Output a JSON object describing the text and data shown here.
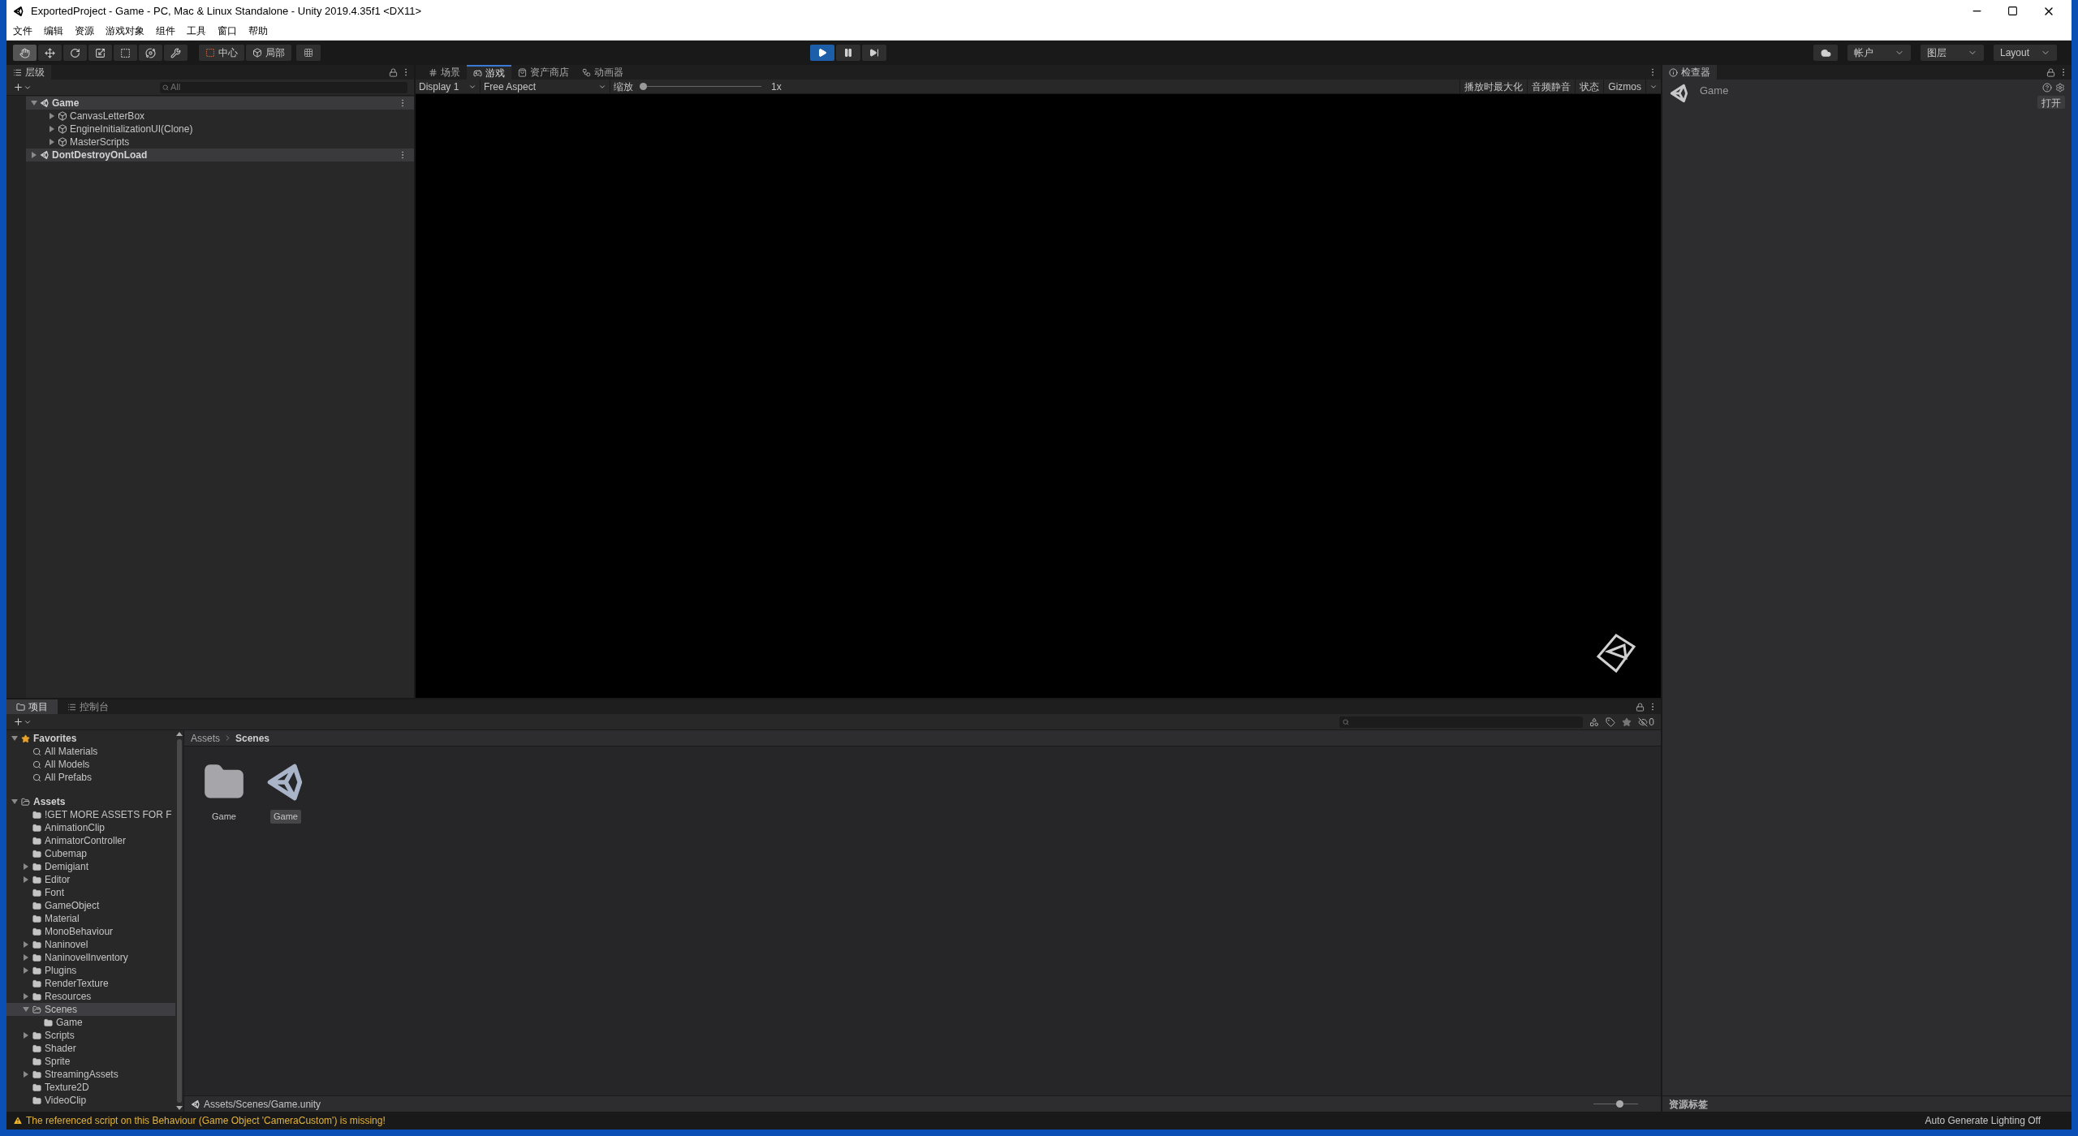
{
  "window": {
    "title": "ExportedProject - Game - PC, Mac & Linux Standalone - Unity 2019.4.35f1 <DX11>"
  },
  "menu": [
    "文件",
    "编辑",
    "资源",
    "游戏对象",
    "组件",
    "工具",
    "窗口",
    "帮助"
  ],
  "tools": [
    {
      "kind": "hand",
      "selected": true
    },
    {
      "kind": "move",
      "selected": false
    },
    {
      "kind": "rotate",
      "selected": false
    },
    {
      "kind": "scale",
      "selected": false
    },
    {
      "kind": "rect",
      "selected": false
    },
    {
      "kind": "transform",
      "selected": false
    },
    {
      "kind": "custom",
      "selected": false
    }
  ],
  "pivot_buttons": [
    {
      "kind": "center",
      "label": "中心"
    },
    {
      "kind": "local",
      "label": "局部"
    }
  ],
  "playback": [
    {
      "kind": "play",
      "on": true
    },
    {
      "kind": "pause",
      "on": false
    },
    {
      "kind": "step",
      "on": false
    }
  ],
  "right_toolbar": {
    "account": "帐户",
    "layers": "图层",
    "layout": "Layout"
  },
  "hierarchy": {
    "tab": "层级",
    "search": {
      "placeholder": "All"
    },
    "items": [
      {
        "kind": "scene",
        "label": "Game",
        "expanded": true,
        "children": [
          {
            "kind": "object",
            "label": "CanvasLetterBox",
            "expanded": false
          },
          {
            "kind": "object",
            "label": "EngineInitializationUI(Clone)",
            "expanded": false
          },
          {
            "kind": "object",
            "label": "MasterScripts",
            "expanded": false
          }
        ]
      },
      {
        "kind": "scene",
        "label": "DontDestroyOnLoad",
        "expanded": false
      }
    ]
  },
  "view_tabs": [
    {
      "kind": "scene",
      "label": "场景",
      "selected": false
    },
    {
      "kind": "game",
      "label": "游戏",
      "selected": true
    },
    {
      "kind": "store",
      "label": "资产商店",
      "selected": false
    },
    {
      "kind": "animator",
      "label": "动画器",
      "selected": false
    }
  ],
  "game_toolbar": {
    "display": "Display 1",
    "aspect": "Free Aspect",
    "scale_label": "缩放",
    "scale": {
      "level": 0,
      "reading": "1x"
    },
    "toggles": [
      {
        "label": "播放时最大化",
        "on": false
      },
      {
        "label": "音频静音",
        "on": false
      },
      {
        "label": "状态",
        "on": false
      },
      {
        "label": "Gizmos",
        "on": false
      }
    ]
  },
  "inspector": {
    "tab": "检查器",
    "object": "Game",
    "open_button": "打开",
    "footer": "资源标签"
  },
  "bottom_tabs": [
    {
      "kind": "project",
      "label": "项目",
      "selected": true
    },
    {
      "kind": "console",
      "label": "控制台",
      "selected": false
    }
  ],
  "project": {
    "hidden_count": "0",
    "breadcrumb": [
      "Assets",
      "Scenes"
    ],
    "tree": [
      {
        "kind": "favorites",
        "label": "Favorites",
        "expanded": true,
        "selected": false,
        "children": [
          {
            "kind": "search",
            "label": "All Materials",
            "selected": false
          },
          {
            "kind": "search",
            "label": "All Models",
            "selected": false
          },
          {
            "kind": "search",
            "label": "All Prefabs",
            "selected": false
          }
        ]
      },
      {
        "kind": "root",
        "label": "Assets",
        "expanded": true,
        "selected": false,
        "children": [
          {
            "kind": "folder",
            "label": "!GET MORE ASSETS FOR F",
            "selected": false
          },
          {
            "kind": "folder",
            "label": "AnimationClip",
            "selected": false
          },
          {
            "kind": "folder",
            "label": "AnimatorController",
            "selected": false
          },
          {
            "kind": "folder",
            "label": "Cubemap",
            "selected": false
          },
          {
            "kind": "folder",
            "label": "Demigiant",
            "expanded": false,
            "selected": false
          },
          {
            "kind": "folder",
            "label": "Editor",
            "expanded": false,
            "selected": false
          },
          {
            "kind": "folder",
            "label": "Font",
            "selected": false
          },
          {
            "kind": "folder",
            "label": "GameObject",
            "selected": false
          },
          {
            "kind": "folder",
            "label": "Material",
            "selected": false
          },
          {
            "kind": "folder",
            "label": "MonoBehaviour",
            "selected": false
          },
          {
            "kind": "folder",
            "label": "Naninovel",
            "expanded": false,
            "selected": false
          },
          {
            "kind": "folder",
            "label": "NaninovelInventory",
            "expanded": false,
            "selected": false
          },
          {
            "kind": "folder",
            "label": "Plugins",
            "expanded": false,
            "selected": false
          },
          {
            "kind": "folder",
            "label": "RenderTexture",
            "selected": false
          },
          {
            "kind": "folder",
            "label": "Resources",
            "expanded": false,
            "selected": false
          },
          {
            "kind": "folder",
            "label": "Scenes",
            "expanded": true,
            "selected": true,
            "children": [
              {
                "kind": "folder",
                "label": "Game",
                "selected": false
              }
            ]
          },
          {
            "kind": "folder",
            "label": "Scripts",
            "expanded": false,
            "selected": false
          },
          {
            "kind": "folder",
            "label": "Shader",
            "selected": false
          },
          {
            "kind": "folder",
            "label": "Sprite",
            "selected": false
          },
          {
            "kind": "folder",
            "label": "StreamingAssets",
            "expanded": false,
            "selected": false
          },
          {
            "kind": "folder",
            "label": "Texture2D",
            "selected": false
          },
          {
            "kind": "folder",
            "label": "VideoClip",
            "selected": false
          }
        ]
      }
    ],
    "grid": [
      {
        "kind": "folder",
        "label": "Game",
        "selected": false
      },
      {
        "kind": "scene",
        "label": "Game",
        "selected": true
      }
    ],
    "path": "Assets/Scenes/Game.unity",
    "zoom": {
      "level": 0.6
    }
  },
  "status_bar": {
    "message": "The referenced script on this Behaviour (Game Object 'CameraCustom') is missing!",
    "lighting": "Auto Generate Lighting Off"
  }
}
